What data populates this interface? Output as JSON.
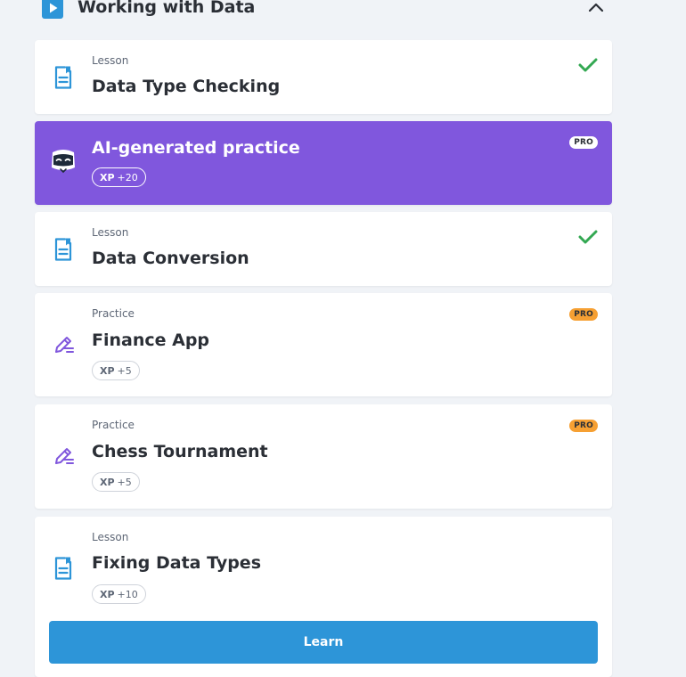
{
  "section": {
    "title": "Working with Data",
    "icon": "play-square-icon",
    "collapse_icon": "chevron-up-icon"
  },
  "colors": {
    "background": "#f0f3f7",
    "ai_card": "#8057dd",
    "lesson_icon": "#2d95d8",
    "practice_icon": "#8057dd",
    "check": "#33a852",
    "pro_badge": "#f6a033",
    "learn_button": "#2d95d8"
  },
  "items": [
    {
      "kind": "lesson",
      "type_label": "Lesson",
      "title": "Data Type Checking",
      "icon": "lesson-document-icon",
      "completed": true,
      "status_icon": "check-icon"
    },
    {
      "kind": "ai-practice",
      "title": "AI-generated practice",
      "icon": "robot-face-icon",
      "badge": "PRO",
      "xp_label": "XP",
      "xp_value": "+20"
    },
    {
      "kind": "lesson",
      "type_label": "Lesson",
      "title": "Data Conversion",
      "icon": "lesson-document-icon",
      "completed": true,
      "status_icon": "check-icon"
    },
    {
      "kind": "practice",
      "type_label": "Practice",
      "title": "Finance App",
      "icon": "pencil-lines-icon",
      "badge": "PRO",
      "xp_label": "XP",
      "xp_value": "+5"
    },
    {
      "kind": "practice",
      "type_label": "Practice",
      "title": "Chess Tournament",
      "icon": "pencil-lines-icon",
      "badge": "PRO",
      "xp_label": "XP",
      "xp_value": "+5"
    },
    {
      "kind": "lesson",
      "type_label": "Lesson",
      "title": "Fixing Data Types",
      "icon": "lesson-document-icon",
      "xp_label": "XP",
      "xp_value": "+10",
      "button_label": "Learn"
    }
  ]
}
